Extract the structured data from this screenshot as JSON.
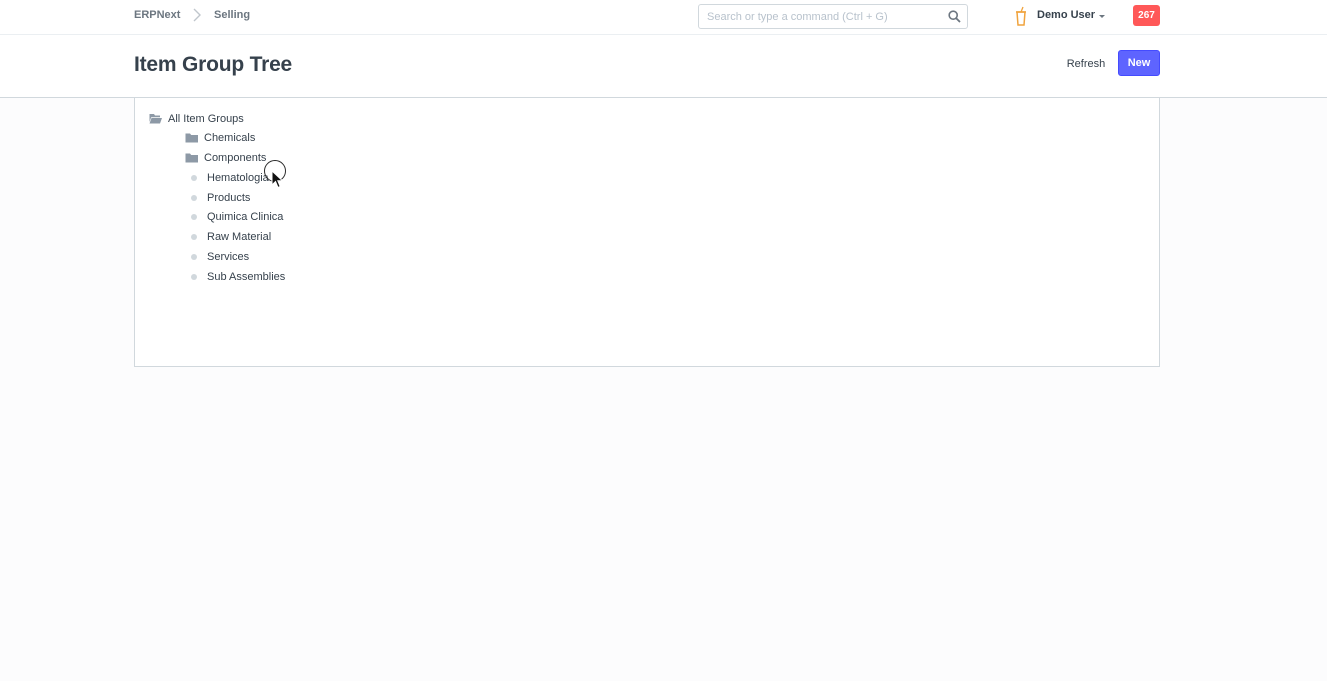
{
  "navbar": {
    "brand": "ERPNext",
    "breadcrumb": "Selling",
    "search_placeholder": "Search or type a command (Ctrl + G)",
    "user_name": "Demo User",
    "notification_count": "267"
  },
  "page": {
    "title": "Item Group Tree",
    "refresh_label": "Refresh",
    "new_label": "New"
  },
  "tree": {
    "root": "All Item Groups",
    "groups": [
      "Chemicals",
      "Components"
    ],
    "leaves": [
      "Hematologia",
      "Products",
      "Quimica Clinica",
      "Raw Material",
      "Services",
      "Sub Assemblies"
    ]
  },
  "colors": {
    "primary": "#5e64ff",
    "badge": "#ff5858",
    "folder_icon": "#8d99a6",
    "leaf_dot": "#d1d8dd",
    "cup_icon": "#f0a33d"
  }
}
